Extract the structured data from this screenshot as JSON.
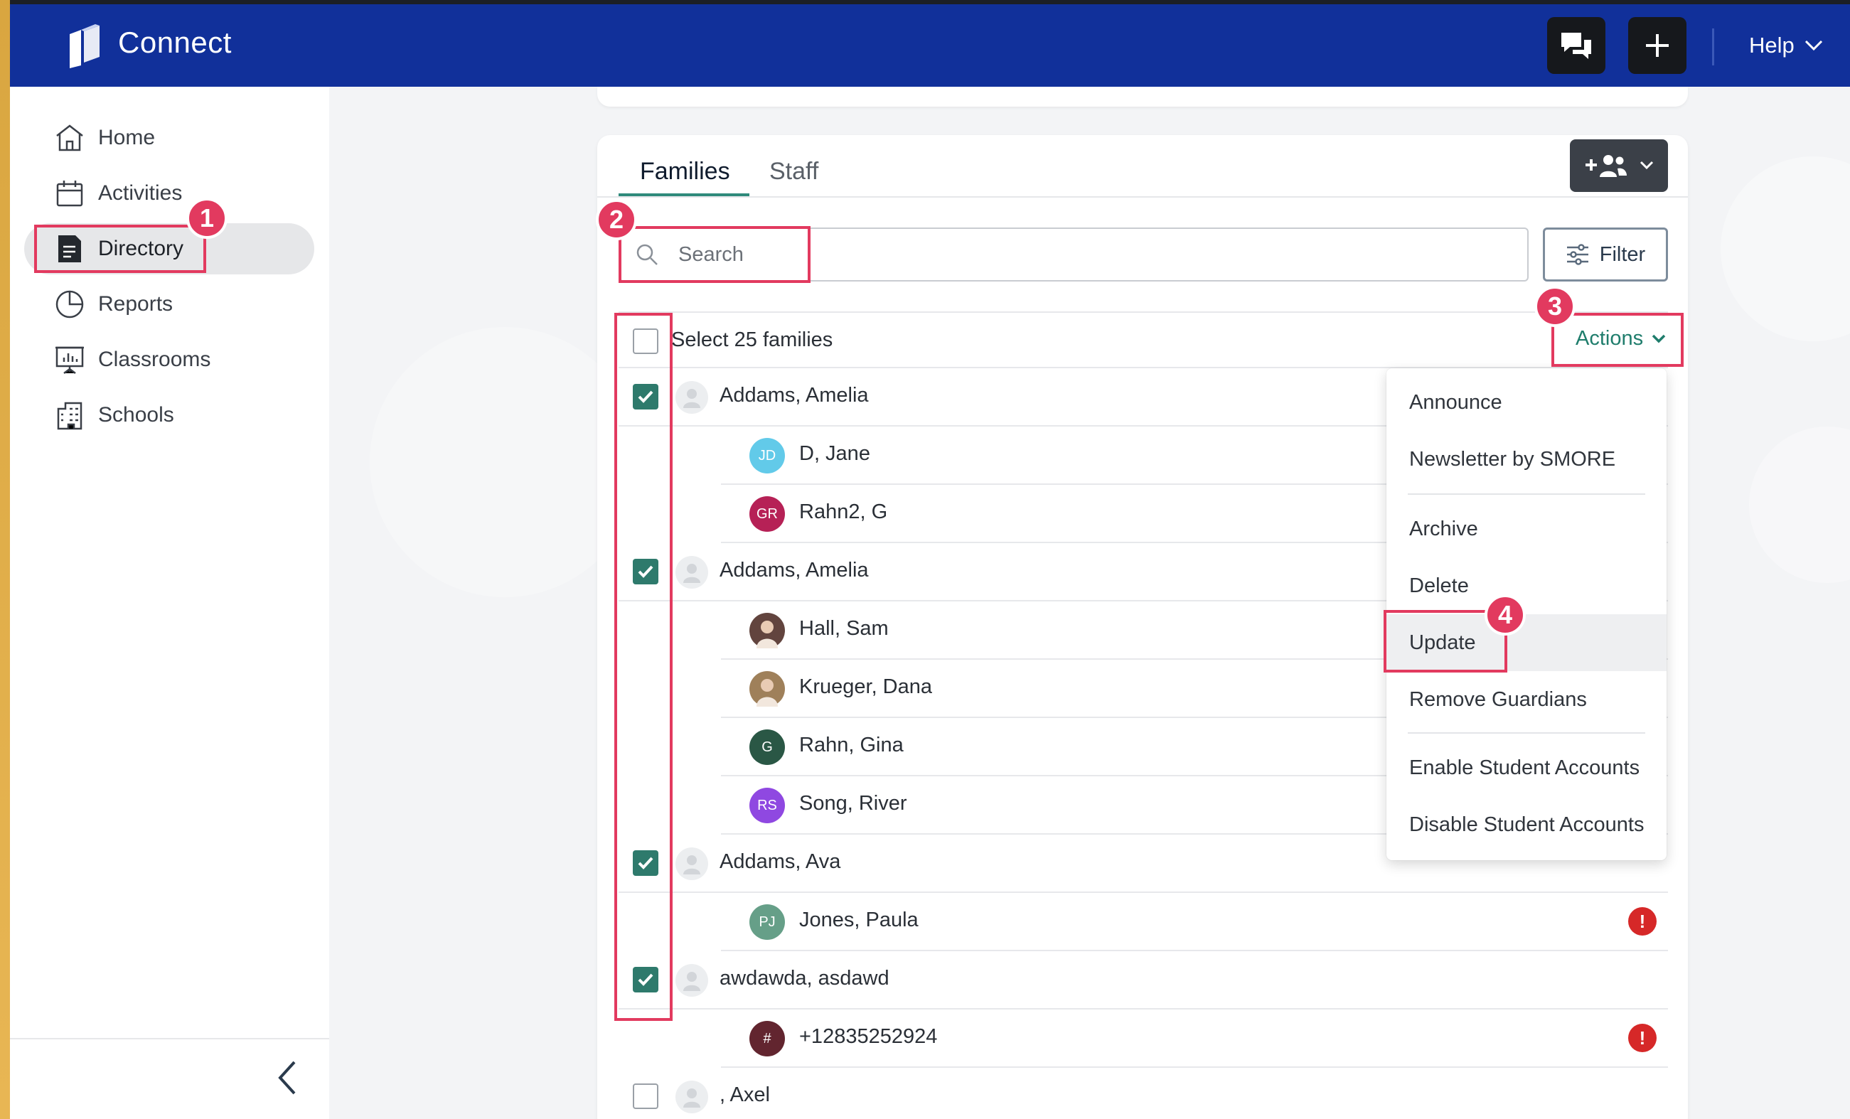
{
  "app": {
    "brand": "Connect"
  },
  "header": {
    "help_label": "Help"
  },
  "sidebar": {
    "items": [
      {
        "label": "Home",
        "icon": "home-icon"
      },
      {
        "label": "Activities",
        "icon": "calendar-icon"
      },
      {
        "label": "Directory",
        "icon": "directory-icon",
        "active": true
      },
      {
        "label": "Reports",
        "icon": "pie-chart-icon"
      },
      {
        "label": "Classrooms",
        "icon": "presentation-board-icon"
      },
      {
        "label": "Schools",
        "icon": "building-icon"
      }
    ]
  },
  "tabs": [
    {
      "label": "Families",
      "active": true
    },
    {
      "label": "Staff",
      "active": false
    }
  ],
  "search": {
    "placeholder": "Search"
  },
  "filter": {
    "label": "Filter"
  },
  "select_all": {
    "label": "Select 25 families",
    "checked": false
  },
  "actions": {
    "label": "Actions"
  },
  "rows": [
    {
      "type": "family",
      "name": "Addams, Amelia",
      "checked": true
    },
    {
      "type": "member",
      "name": "D, Jane",
      "initials": "JD",
      "color": "#5ac8e8"
    },
    {
      "type": "member",
      "name": "Rahn2, G",
      "initials": "GR",
      "color": "#b3164e"
    },
    {
      "type": "family",
      "name": "Addams, Amelia",
      "checked": true
    },
    {
      "type": "member",
      "name": "Hall, Sam",
      "photo": true,
      "color": "#5a3b34"
    },
    {
      "type": "member",
      "name": "Krueger, Dana",
      "photo": true,
      "color": "#9a7a52"
    },
    {
      "type": "member",
      "name": "Rahn, Gina",
      "initials": "G",
      "color": "#1f4f3c"
    },
    {
      "type": "member",
      "name": "Song, River",
      "initials": "RS",
      "color": "#8a3fe0"
    },
    {
      "type": "family",
      "name": "Addams, Ava",
      "checked": true
    },
    {
      "type": "member",
      "name": "Jones, Paula",
      "initials": "PJ",
      "color": "#5e9a82",
      "alert": "!"
    },
    {
      "type": "family",
      "name": "awdawda, asdawd",
      "checked": true
    },
    {
      "type": "member",
      "name": "+12835252924",
      "initials": "#",
      "color": "#5a1a24",
      "alert": "!"
    },
    {
      "type": "family",
      "name": ", Axel",
      "checked": false
    }
  ],
  "actions_menu": {
    "items": [
      {
        "label": "Announce"
      },
      {
        "label": "Newsletter by SMORE"
      },
      {
        "label": "Archive"
      },
      {
        "label": "Delete"
      },
      {
        "label": "Update",
        "hovered": true
      },
      {
        "label": "Remove Guardians"
      },
      {
        "label": "Enable Student Accounts"
      },
      {
        "label": "Disable Student Accounts"
      }
    ]
  },
  "annotations": [
    {
      "number": "1"
    },
    {
      "number": "2"
    },
    {
      "number": "3"
    },
    {
      "number": "4"
    }
  ],
  "colors": {
    "header": "#11309a",
    "accent": "#2e7a6c",
    "annotation": "#e23a5f",
    "alert": "#d62828"
  }
}
